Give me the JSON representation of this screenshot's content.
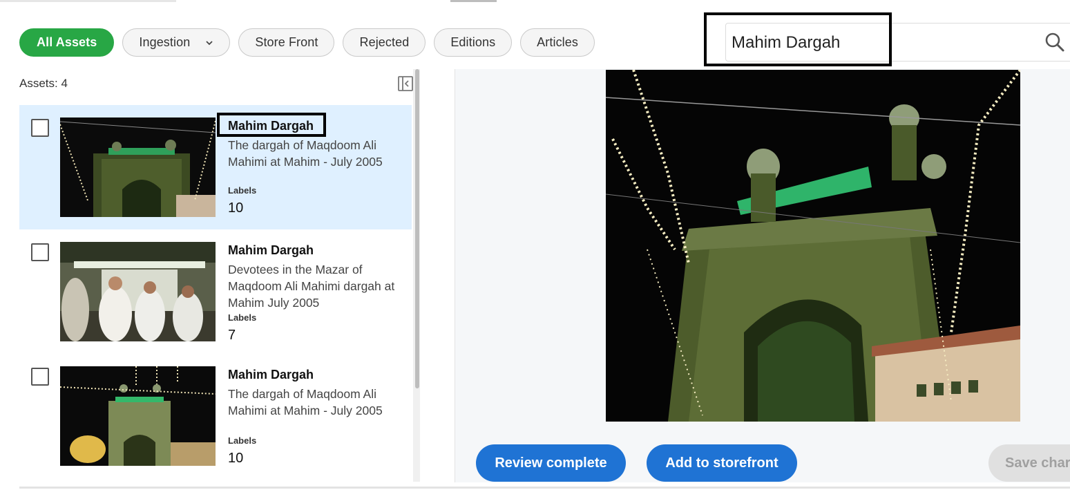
{
  "filters": {
    "chips": [
      {
        "label": "All Assets",
        "active": true
      },
      {
        "label": "Ingestion",
        "has_dropdown": true
      },
      {
        "label": "Store Front"
      },
      {
        "label": "Rejected"
      },
      {
        "label": "Editions"
      },
      {
        "label": "Articles"
      }
    ]
  },
  "search": {
    "value": "Mahim Dargah",
    "icon": "search-icon"
  },
  "assets_panel": {
    "count_label": "Assets: 4",
    "items": [
      {
        "title": "Mahim Dargah",
        "description": "The dargah of Maqdoom Ali Mahimi at Mahim - July 2005",
        "labels_key": "Labels",
        "labels_value": "10",
        "selected": true
      },
      {
        "title": "Mahim Dargah",
        "description": "Devotees in the Mazar of Maqdoom Ali Mahimi dargah at Mahim July 2005",
        "labels_key": "Labels",
        "labels_value": "7",
        "selected": false
      },
      {
        "title": "Mahim Dargah",
        "description": "The dargah of Maqdoom Ali Mahimi at Mahim - July 2005",
        "labels_key": "Labels",
        "labels_value": "10",
        "selected": false
      }
    ]
  },
  "actions": {
    "review_complete": "Review complete",
    "add_to_storefront": "Add to storefront",
    "save_changes": "Save char"
  },
  "colors": {
    "active_chip": "#28a745",
    "primary_button": "#1f73d4",
    "selected_row": "#dff0ff"
  }
}
